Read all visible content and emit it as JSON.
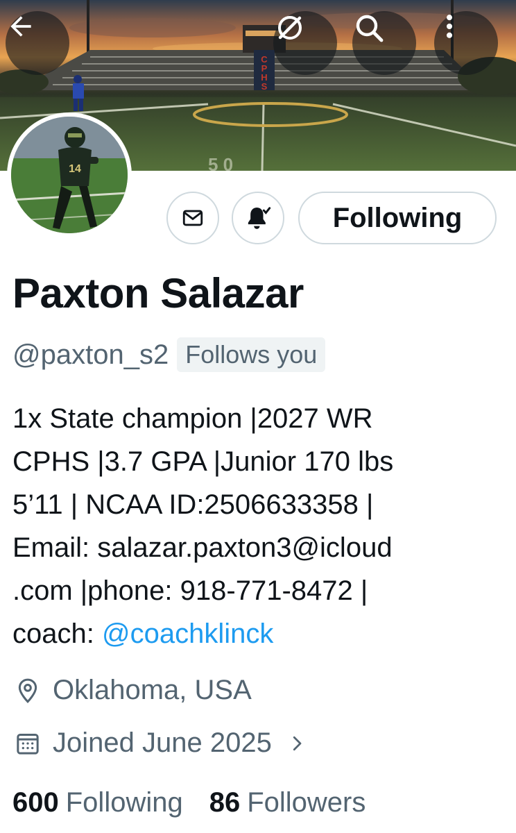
{
  "header": {
    "back_icon": "arrow-left-icon",
    "grok_icon": "grok-slash-circle-icon",
    "search_icon": "search-icon",
    "more_icon": "more-vertical-icon"
  },
  "banner": {
    "stadium_letters": "CPHS"
  },
  "actions": {
    "message_icon": "mail-icon",
    "notify_icon": "bell-check-icon",
    "following_label": "Following"
  },
  "profile": {
    "display_name": "Paxton Salazar",
    "handle": "@paxton_s2",
    "follows_you": "Follows you",
    "jersey_number": "14",
    "bio_lines": [
      "1x State champion |2027 WR",
      "CPHS |3.7 GPA |Junior 170 lbs",
      "5’11 | NCAA ID:2506633358 |",
      "Email: salazar.paxton3@icloud",
      ".com |phone: 918-771-8472 |"
    ],
    "bio_last_prefix": "coach: ",
    "bio_mention": "@coachklinck",
    "location": "Oklahoma, USA",
    "joined": "Joined June 2025",
    "following_count": "600",
    "following_label": "Following",
    "followers_count": "86",
    "followers_label": "Followers"
  },
  "colors": {
    "accent": "#1d9bf0",
    "secondary_text": "#536471",
    "primary_text": "#0f1419",
    "border": "#cfd9de"
  }
}
